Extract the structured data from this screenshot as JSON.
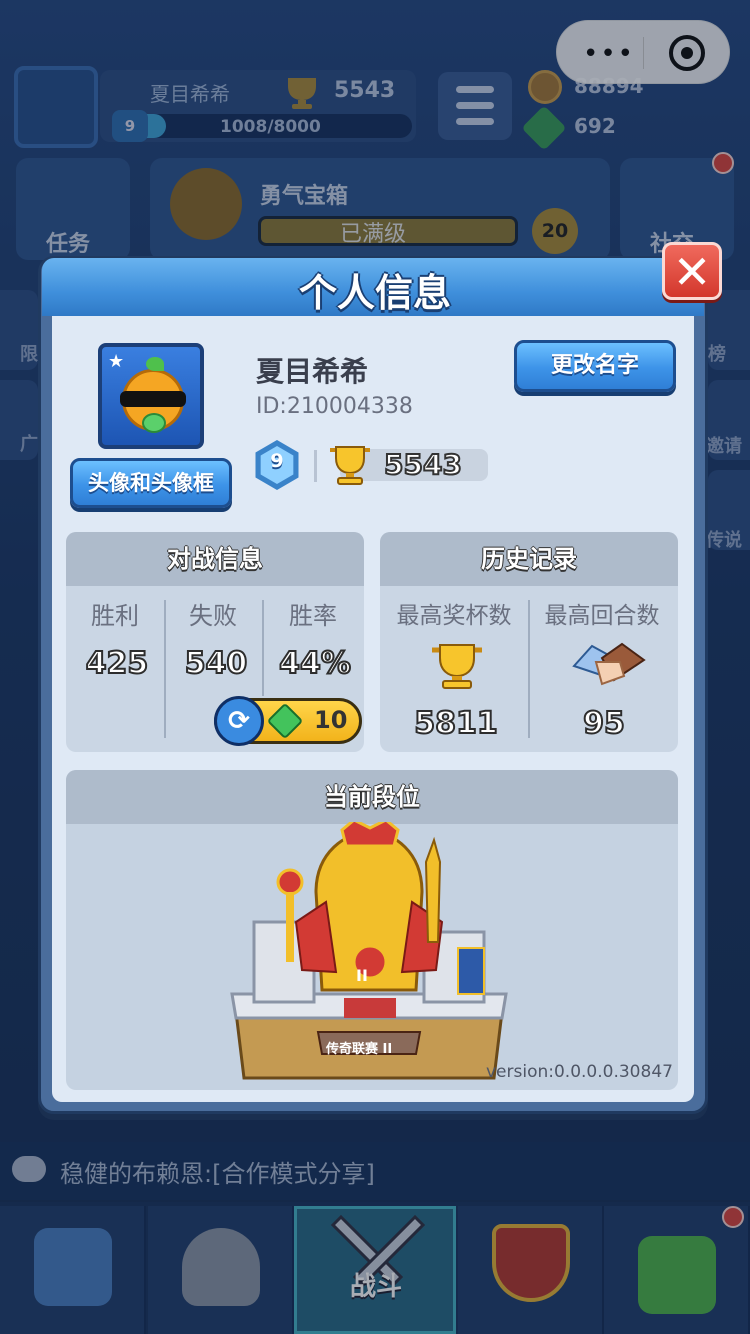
{
  "hud": {
    "player_name": "夏目希希",
    "trophies": "5543",
    "level": "9",
    "xp": "1008/8000",
    "xp_progress": 0.126,
    "coins": "88894",
    "gems": "692",
    "task_label": "任务",
    "chest_title": "勇气宝箱",
    "chest_status": "已满级",
    "chest_count": "20",
    "social_label": "社交",
    "left_side": [
      "限",
      "广"
    ],
    "right_side": [
      "榜",
      "邀请",
      "传说"
    ]
  },
  "modal": {
    "title": "个人信息",
    "close_label": "✕",
    "profile": {
      "name": "夏目希希",
      "id": "ID:210004338",
      "level": "9",
      "trophies": "5543",
      "avatar_button": "头像和头像框",
      "rename_button": "更改名字"
    },
    "battle_info": {
      "title": "对战信息",
      "columns": [
        {
          "label": "胜利",
          "value": "425"
        },
        {
          "label": "失败",
          "value": "540"
        },
        {
          "label": "胜率",
          "value": "44%"
        }
      ],
      "reroll_cost": "10"
    },
    "history": {
      "title": "历史记录",
      "columns": [
        {
          "label": "最高奖杯数",
          "value": "5811"
        },
        {
          "label": "最高回合数",
          "value": "95"
        }
      ]
    },
    "rank": {
      "title": "当前段位",
      "badge_label": "传奇联赛 II",
      "tier_numeral": "II",
      "version": "version:0.0.0.0.30847"
    }
  },
  "chat": {
    "message": "稳健的布赖恩:[合作模式分享]"
  },
  "tabs": [
    {
      "name": "shop",
      "label": ""
    },
    {
      "name": "heroes",
      "label": ""
    },
    {
      "name": "battle",
      "label": "战斗"
    },
    {
      "name": "clan",
      "label": ""
    },
    {
      "name": "garden",
      "label": ""
    }
  ],
  "colors": {
    "accent_blue": "#3d93e8",
    "close_red": "#d3372c",
    "gold": "#f2b31b",
    "gem_green": "#43c35c"
  }
}
